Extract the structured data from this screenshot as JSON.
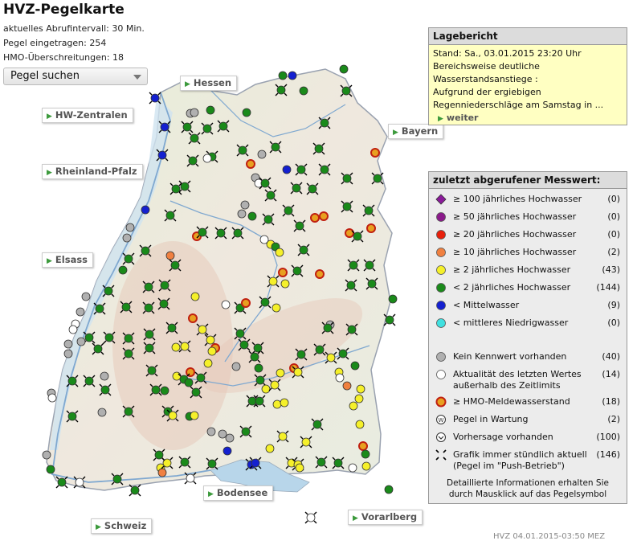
{
  "header": {
    "title": "HVZ-Pegelkarte",
    "interval": "aktuelles Abrufintervall: 30 Min.",
    "gauges": "Pegel eingetragen: 254",
    "hmo": "HMO-Überschreitungen: 18",
    "search_label": "Pegel suchen"
  },
  "nav": {
    "hessen": "Hessen",
    "hw_zentralen": "HW-Zentralen",
    "bayern": "Bayern",
    "rheinland_pfalz": "Rheinland-Pfalz",
    "elsass": "Elsass",
    "bodensee": "Bodensee",
    "schweiz": "Schweiz",
    "vorarlberg": "Vorarlberg"
  },
  "lagebericht": {
    "title": "Lagebericht",
    "line1": "Stand: Sa., 03.01.2015 23:20 Uhr",
    "line2": "Bereichsweise deutliche",
    "line3": "Wasserstandsanstiege :",
    "line4": "Aufgrund der ergiebigen",
    "line5": "Regenniederschläge am Samstag in ...",
    "more": "weiter"
  },
  "legend": {
    "title": "zuletzt abgerufener Messwert:",
    "items": [
      {
        "label": "≥ 100 jährliches Hochwasser",
        "count": "(0)",
        "color": "#8b1a9b",
        "icon": "diamond-icon"
      },
      {
        "label": "≥ 50 jährliches Hochwasser",
        "count": "(0)",
        "color": "#8b1a8b",
        "icon": "circle-icon"
      },
      {
        "label": "≥ 20 jährliches Hochwasser",
        "count": "(0)",
        "color": "#e8200c",
        "icon": "circle-icon"
      },
      {
        "label": "≥ 10 jährliches Hochwasser",
        "count": "(2)",
        "color": "#f08040",
        "icon": "circle-icon"
      },
      {
        "label": "≥ 2 jährliches Hochwasser",
        "count": "(43)",
        "color": "#f5f02a",
        "icon": "circle-icon"
      },
      {
        "label": "< 2 jährliches Hochwasser",
        "count": "(144)",
        "color": "#1a8a1a",
        "icon": "circle-icon"
      },
      {
        "label": "< Mittelwasser",
        "count": "(9)",
        "color": "#1420d0",
        "icon": "circle-icon"
      },
      {
        "label": "< mittleres Niedrigwasser",
        "count": "(0)",
        "color": "#40e0e0",
        "icon": "circle-icon"
      },
      {
        "label": "Kein Kennwert vorhanden",
        "count": "(40)",
        "color": "#b0b0b0",
        "icon": "circle-icon"
      },
      {
        "label": "Aktualität des letzten Wertes außerhalb des Zeitlimits",
        "count": "(14)",
        "color": "#ffffff",
        "icon": "circle-icon"
      },
      {
        "label": "≥ HMO-Meldewasserstand",
        "count": "(18)",
        "color": "#e8a020",
        "icon": "hmo-icon"
      },
      {
        "label": "Pegel in Wartung",
        "count": "(2)",
        "color": "#ffffff",
        "icon": "wartung-icon"
      },
      {
        "label": "Vorhersage vorhanden",
        "count": "(100)",
        "color": "#ffffff",
        "icon": "forecast-icon"
      },
      {
        "label": "Grafik immer stündlich aktuell (Pegel im \"Push-Betrieb\")",
        "count": "(146)",
        "color": "#000000",
        "icon": "push-icon"
      }
    ],
    "note": "Detaillierte Informationen erhalten Sie durch Mausklick auf das Pegelsymbol"
  },
  "footer": {
    "stamp": "HVZ 04.01.2015-03:50 MEZ"
  },
  "colors": {
    "green": "#1a8a1a",
    "yellow": "#f5f02a",
    "blue": "#1420d0",
    "grey": "#b0b0b0",
    "white": "#ffffff",
    "orange": "#f08040",
    "hmo": "#e8a020"
  }
}
